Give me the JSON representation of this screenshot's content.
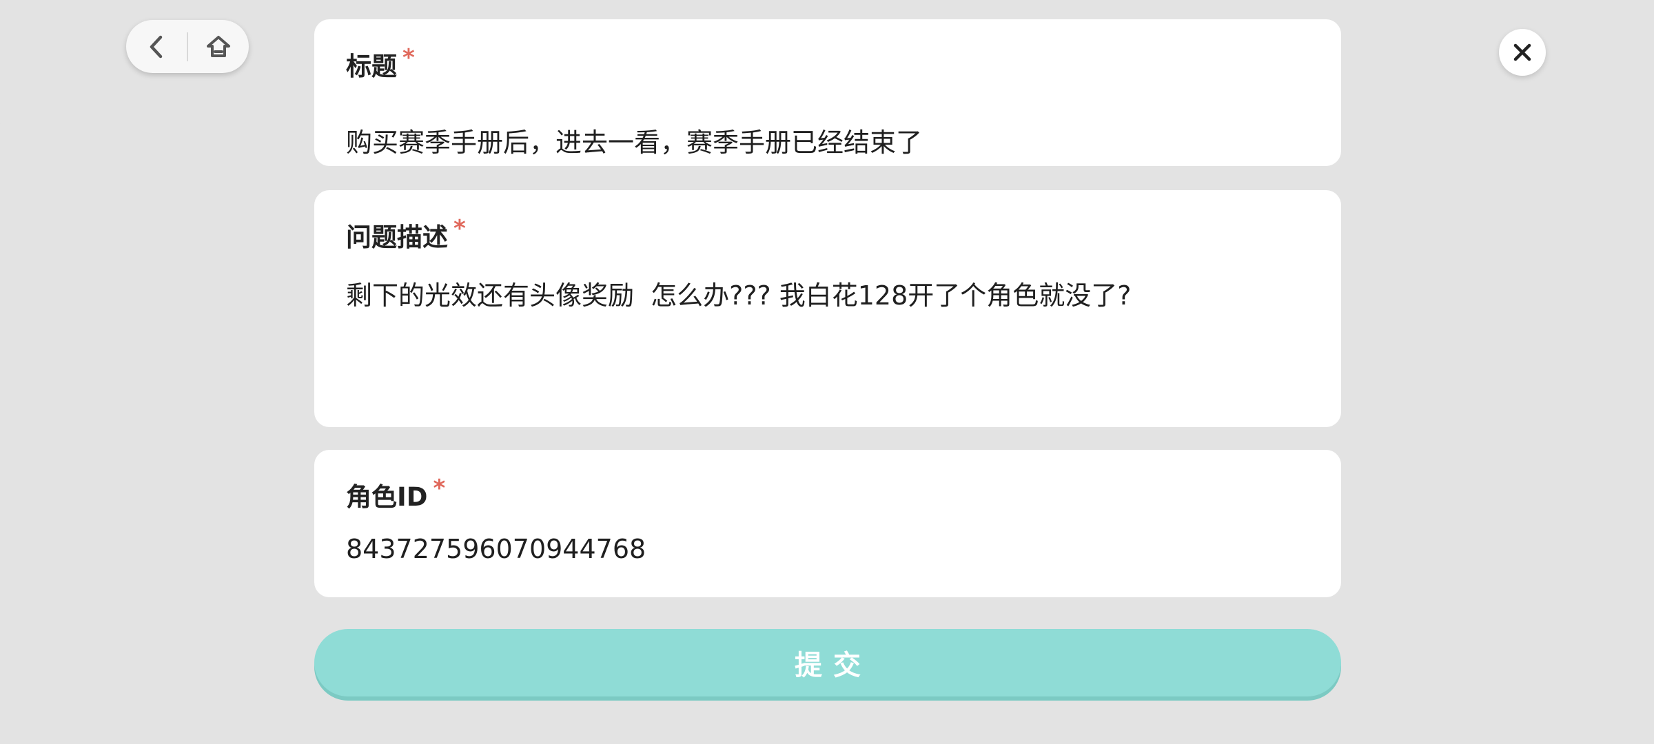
{
  "nav": {
    "back_icon": "chevron-left",
    "home_icon": "home"
  },
  "close_icon": "close-x",
  "form": {
    "title_field": {
      "label": "标题",
      "required_mark": "*",
      "value": "购买赛季手册后，进去一看，赛季手册已经结束了"
    },
    "description_field": {
      "label": "问题描述",
      "required_mark": "*",
      "value": "剩下的光效还有头像奖励  怎么办??? 我白花128开了个角色就没了?"
    },
    "role_id_field": {
      "label": "角色ID",
      "required_mark": "*",
      "value": "843727596070944768"
    },
    "submit_label": "提交"
  },
  "colors": {
    "background": "#e3e3e3",
    "card": "#ffffff",
    "required": "#e0685b",
    "submit": "#8fdcd6"
  }
}
